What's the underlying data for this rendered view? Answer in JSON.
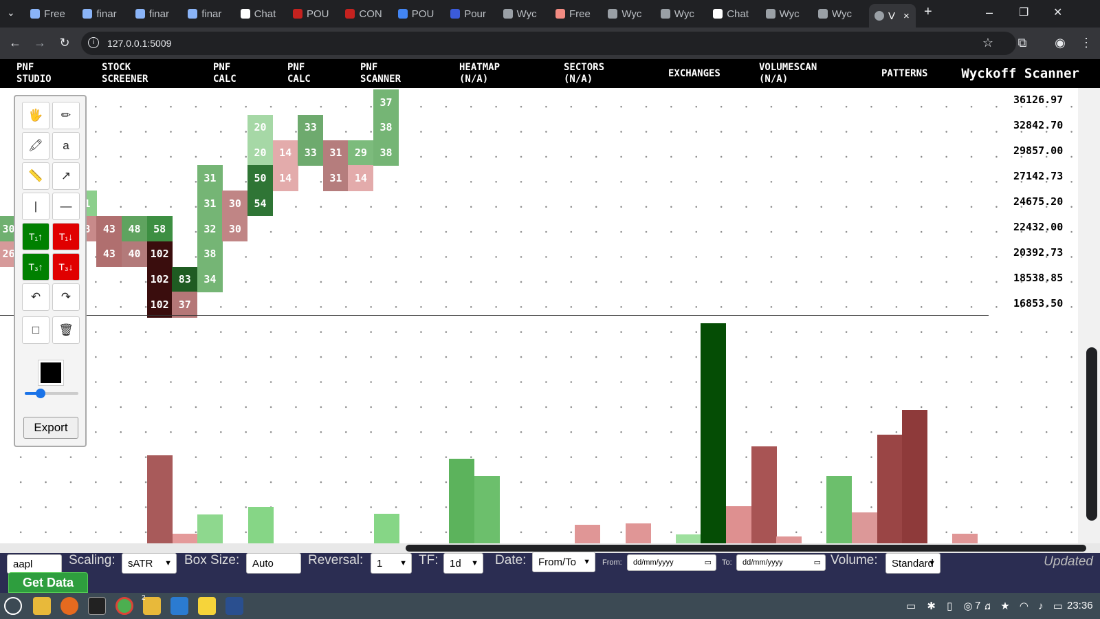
{
  "browser": {
    "tabs": [
      {
        "label": "Free",
        "color": "#8ab4f8"
      },
      {
        "label": "finar",
        "color": "#8ab4f8"
      },
      {
        "label": "finar",
        "color": "#8ab4f8"
      },
      {
        "label": "finar",
        "color": "#8ab4f8"
      },
      {
        "label": "Chat",
        "color": "#ffffff"
      },
      {
        "label": "POU",
        "color": "#c5221f"
      },
      {
        "label": "CON",
        "color": "#c5221f"
      },
      {
        "label": "POU",
        "color": "#4285f4"
      },
      {
        "label": "Pour",
        "color": "#3b5bdb"
      },
      {
        "label": "Wyc",
        "color": "#9aa0a6"
      },
      {
        "label": "Free",
        "color": "#f28b82"
      },
      {
        "label": "Wyc",
        "color": "#9aa0a6"
      },
      {
        "label": "Wyc",
        "color": "#9aa0a6"
      },
      {
        "label": "Chat",
        "color": "#ffffff"
      },
      {
        "label": "Wyc",
        "color": "#9aa0a6"
      },
      {
        "label": "Wyc",
        "color": "#9aa0a6"
      }
    ],
    "active_tab": "V",
    "close_glyph": "×",
    "new_tab_glyph": "+",
    "url": "127.0.0.1:5009",
    "window_controls": {
      "minimize": "–",
      "restore": "❐",
      "close": "✕"
    }
  },
  "app_nav": {
    "items": [
      {
        "line1": "PNF",
        "line2": "STUDIO"
      },
      {
        "line1": "STOCK",
        "line2": "SCREENER"
      },
      {
        "line1": "PNF",
        "line2": "CALC"
      },
      {
        "line1": "PNF",
        "line2": "CALC"
      },
      {
        "line1": "PNF",
        "line2": "SCANNER"
      },
      {
        "line1": "HEATMAP",
        "line2": "(N/A)"
      },
      {
        "line1": "SECTORS",
        "line2": "(N/A)"
      },
      {
        "line1": "EXCHANGES",
        "line2": ""
      },
      {
        "line1": "VOLUMESCAN",
        "line2": "(N/A)"
      },
      {
        "line1": "PATTERNS",
        "line2": ""
      }
    ],
    "brand": "Wyckoff Scanner"
  },
  "price_axis": [
    "36126.97",
    "32842.70",
    "29857.00",
    "27142.73",
    "24675.20",
    "22432.00",
    "20392.73",
    "18538.85",
    "16853.50"
  ],
  "pnf_boxes": [
    {
      "col": 0,
      "row": 5,
      "label": "30",
      "color": "#6fb070"
    },
    {
      "col": 0,
      "row": 6,
      "label": "26",
      "color": "#d69a9a"
    },
    {
      "col": 3,
      "row": 4,
      "label": "31",
      "color": "#8ccf8c"
    },
    {
      "col": 3,
      "row": 5,
      "label": "28",
      "color": "#c88a8a"
    },
    {
      "col": 4,
      "row": 5,
      "label": "43",
      "color": "#b06f6f"
    },
    {
      "col": 4,
      "row": 6,
      "label": "43",
      "color": "#b06f6f"
    },
    {
      "col": 5,
      "row": 5,
      "label": "48",
      "color": "#5fa35f"
    },
    {
      "col": 5,
      "row": 6,
      "label": "40",
      "color": "#b37a7a"
    },
    {
      "col": 6,
      "row": 5,
      "label": "58",
      "color": "#3d8f42"
    },
    {
      "col": 6,
      "row": 6,
      "label": "102",
      "color": "#3a0d0d"
    },
    {
      "col": 6,
      "row": 7,
      "label": "102",
      "color": "#3a0d0d"
    },
    {
      "col": 6,
      "row": 8,
      "label": "102",
      "color": "#3a0d0d"
    },
    {
      "col": 7,
      "row": 7,
      "label": "83",
      "color": "#1f5c22"
    },
    {
      "col": 7,
      "row": 8,
      "label": "37",
      "color": "#b57777"
    },
    {
      "col": 8,
      "row": 3,
      "label": "31",
      "color": "#75b575"
    },
    {
      "col": 8,
      "row": 4,
      "label": "31",
      "color": "#75b575"
    },
    {
      "col": 8,
      "row": 5,
      "label": "32",
      "color": "#75b575"
    },
    {
      "col": 8,
      "row": 6,
      "label": "38",
      "color": "#75b575"
    },
    {
      "col": 8,
      "row": 7,
      "label": "34",
      "color": "#75b575"
    },
    {
      "col": 9,
      "row": 4,
      "label": "30",
      "color": "#c08585"
    },
    {
      "col": 9,
      "row": 5,
      "label": "30",
      "color": "#c08585"
    },
    {
      "col": 10,
      "row": 1,
      "label": "20",
      "color": "#a6d8a6"
    },
    {
      "col": 10,
      "row": 2,
      "label": "20",
      "color": "#a6d8a6"
    },
    {
      "col": 10,
      "row": 3,
      "label": "50",
      "color": "#2f7535"
    },
    {
      "col": 10,
      "row": 4,
      "label": "54",
      "color": "#2f7535"
    },
    {
      "col": 11,
      "row": 2,
      "label": "14",
      "color": "#e3abab"
    },
    {
      "col": 11,
      "row": 3,
      "label": "14",
      "color": "#e3abab"
    },
    {
      "col": 12,
      "row": 1,
      "label": "33",
      "color": "#6eaa6e"
    },
    {
      "col": 12,
      "row": 2,
      "label": "33",
      "color": "#6eaa6e"
    },
    {
      "col": 13,
      "row": 2,
      "label": "31",
      "color": "#b57d7d"
    },
    {
      "col": 13,
      "row": 3,
      "label": "31",
      "color": "#b57d7d"
    },
    {
      "col": 14,
      "row": 2,
      "label": "29",
      "color": "#7cbb7c"
    },
    {
      "col": 14,
      "row": 3,
      "label": "14",
      "color": "#e3abab"
    },
    {
      "col": 15,
      "row": 0,
      "label": "37",
      "color": "#75b575"
    },
    {
      "col": 15,
      "row": 1,
      "label": "38",
      "color": "#75b575"
    },
    {
      "col": 15,
      "row": 2,
      "label": "38",
      "color": "#75b575"
    }
  ],
  "volume_bars": [
    {
      "col": 6,
      "value": 0.4,
      "color": "#a85a5a"
    },
    {
      "col": 7,
      "value": 0.045,
      "color": "#e49a9a"
    },
    {
      "col": 8,
      "value": 0.13,
      "color": "#8ed88e"
    },
    {
      "col": 10,
      "value": 0.165,
      "color": "#86d686"
    },
    {
      "col": 15,
      "value": 0.135,
      "color": "#86d686"
    },
    {
      "col": 18,
      "value": 0.385,
      "color": "#5cb35c"
    },
    {
      "col": 19,
      "value": 0.305,
      "color": "#6cbf6c"
    },
    {
      "col": 23,
      "value": 0.085,
      "color": "#e09696"
    },
    {
      "col": 25,
      "value": 0.09,
      "color": "#e09696"
    },
    {
      "col": 27,
      "value": 0.04,
      "color": "#9ee09e"
    },
    {
      "col": 28,
      "value": 1.0,
      "color": "#054d05"
    },
    {
      "col": 29,
      "value": 0.17,
      "color": "#de9090"
    },
    {
      "col": 30,
      "value": 0.44,
      "color": "#a85454"
    },
    {
      "col": 31,
      "value": 0.03,
      "color": "#e09696"
    },
    {
      "col": 33,
      "value": 0.305,
      "color": "#6cbf6c"
    },
    {
      "col": 34,
      "value": 0.14,
      "color": "#dc9898"
    },
    {
      "col": 35,
      "value": 0.495,
      "color": "#9a4545"
    },
    {
      "col": 36,
      "value": 0.605,
      "color": "#8e3a3a"
    },
    {
      "col": 38,
      "value": 0.045,
      "color": "#e09696"
    }
  ],
  "tools": {
    "pan": "🖐",
    "pencil": "✏",
    "marker": "🖍",
    "text": "a",
    "ruler": "📏",
    "arrow": "↗",
    "vline": "|",
    "hline": "—",
    "t1_up": "T₁↑",
    "t1_down": "T₁↓",
    "t3_up": "T₃↑",
    "t3_down": "T₃↓",
    "undo": "↶",
    "redo": "↷",
    "rect": "□",
    "trash": "🗑",
    "export": "Export",
    "brush_level": 0.3
  },
  "controls": {
    "symbol": "aapl",
    "scaling_label": "Scaling:",
    "scaling": "sATR",
    "boxsize_label": "Box Size:",
    "boxsize": "Auto",
    "reversal_label": "Reversal:",
    "reversal": "1",
    "tf_label": "TF:",
    "tf": "1d",
    "date_label": "Date:",
    "date_mode": "From/To",
    "from_label": "From:",
    "from_placeholder": "dd/mm/yyyy",
    "to_label": "To:",
    "to_placeholder": "dd/mm/yyyy",
    "volume_label": "Volume:",
    "volume": "Standard",
    "get_data": "Get Data",
    "status": "Updated"
  },
  "taskbar": {
    "clock": "23:36",
    "notif_count": "7",
    "files_badge": "2",
    "apps": [
      "mint-menu",
      "files",
      "firefox",
      "terminal",
      "chrome",
      "files-2",
      "vscode",
      "notes",
      "pen"
    ]
  }
}
